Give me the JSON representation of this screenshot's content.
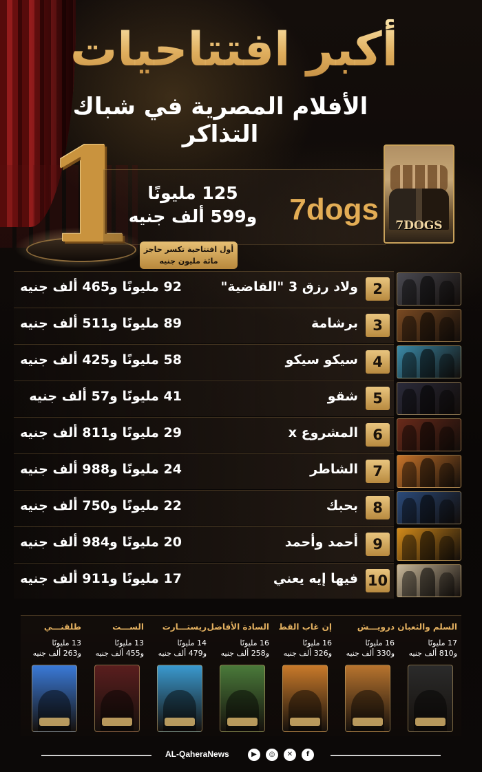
{
  "header": {
    "title": "أكبر افتتاحيات",
    "subtitle": "الأفلام المصرية في شباك التذاكر"
  },
  "top_film": {
    "rank": "1",
    "title": "7dogs",
    "amount_line1": "125 مليونًا",
    "amount_line2": "و599 ألف جنيه",
    "note_line1": "أول افتتاحية تكسر حاجز",
    "note_line2": "مائة مليون جنيه",
    "poster_text": "7DOGS"
  },
  "ranking": [
    {
      "rank": "2",
      "title": "ولاد رزق 3 \"القاضية\"",
      "amount": "92  مليونًا و465 ألف جنيه",
      "thumb_color": "#4a4a52"
    },
    {
      "rank": "3",
      "title": "برشامة",
      "amount": "89 مليونًا و511 ألف جنيه",
      "thumb_color": "#7a4a22"
    },
    {
      "rank": "4",
      "title": "سيكو سيكو",
      "amount": "58 مليونًا و425 ألف جنيه",
      "thumb_color": "#3a8aa8"
    },
    {
      "rank": "5",
      "title": "شقو",
      "amount": "41 مليونًا و57 ألف جنيه",
      "thumb_color": "#2a2a3a"
    },
    {
      "rank": "6",
      "title": "المشروع x",
      "amount": "29 مليونًا و811 ألف جنيه",
      "thumb_color": "#6a2a1a"
    },
    {
      "rank": "7",
      "title": "الشاطر",
      "amount": "24 مليونًا و988 ألف جنيه",
      "thumb_color": "#c8742a"
    },
    {
      "rank": "8",
      "title": "بحبك",
      "amount": "22 مليونًا و750 ألف جنيه",
      "thumb_color": "#2a4a7a"
    },
    {
      "rank": "9",
      "title": "أحمد وأحمد",
      "amount": "20 مليونًا و984 ألف جنيه",
      "thumb_color": "#d28a1a"
    },
    {
      "rank": "10",
      "title": "فيها إيه يعني",
      "amount": "17 مليونًا و911 ألف جنيه",
      "thumb_color": "#c9b89a"
    }
  ],
  "others": [
    {
      "title": "السلم والثعبان",
      "amount_line1": "17 مليونًا",
      "amount_line2": "و810 ألف جنيه",
      "poster_color": "#2b2b2b"
    },
    {
      "title": "درويـــش",
      "amount_line1": "16 مليونًا",
      "amount_line2": "و330 ألف جنيه",
      "poster_color": "#b8742e"
    },
    {
      "title": "إن غاب القط",
      "amount_line1": "16 مليونًا",
      "amount_line2": "و326 ألف جنيه",
      "poster_color": "#c97a2a"
    },
    {
      "title": "السادة الأفاضل",
      "amount_line1": "16 مليونًا",
      "amount_line2": "و258 ألف جنيه",
      "poster_color": "#4a7a3a"
    },
    {
      "title": "ريستـــارت",
      "amount_line1": "14 مليونًا",
      "amount_line2": "و479 ألف جنيه",
      "poster_color": "#3a9ad0"
    },
    {
      "title": "الســـت",
      "amount_line1": "13 مليونًا",
      "amount_line2": "و455 ألف جنيه",
      "poster_color": "#5a1e1e"
    },
    {
      "title": "طلقنـــي",
      "amount_line1": "13 مليونًا",
      "amount_line2": "و263 ألف جنيه",
      "poster_color": "#3a7ad8"
    }
  ],
  "footer": {
    "brand": "AL-QaheraNews",
    "icons": [
      "youtube-icon",
      "instagram-icon",
      "x-icon",
      "facebook-icon"
    ]
  },
  "colors": {
    "gold": "#d7a24f",
    "background": "#0b0807",
    "curtain": "#9b1d1d"
  }
}
